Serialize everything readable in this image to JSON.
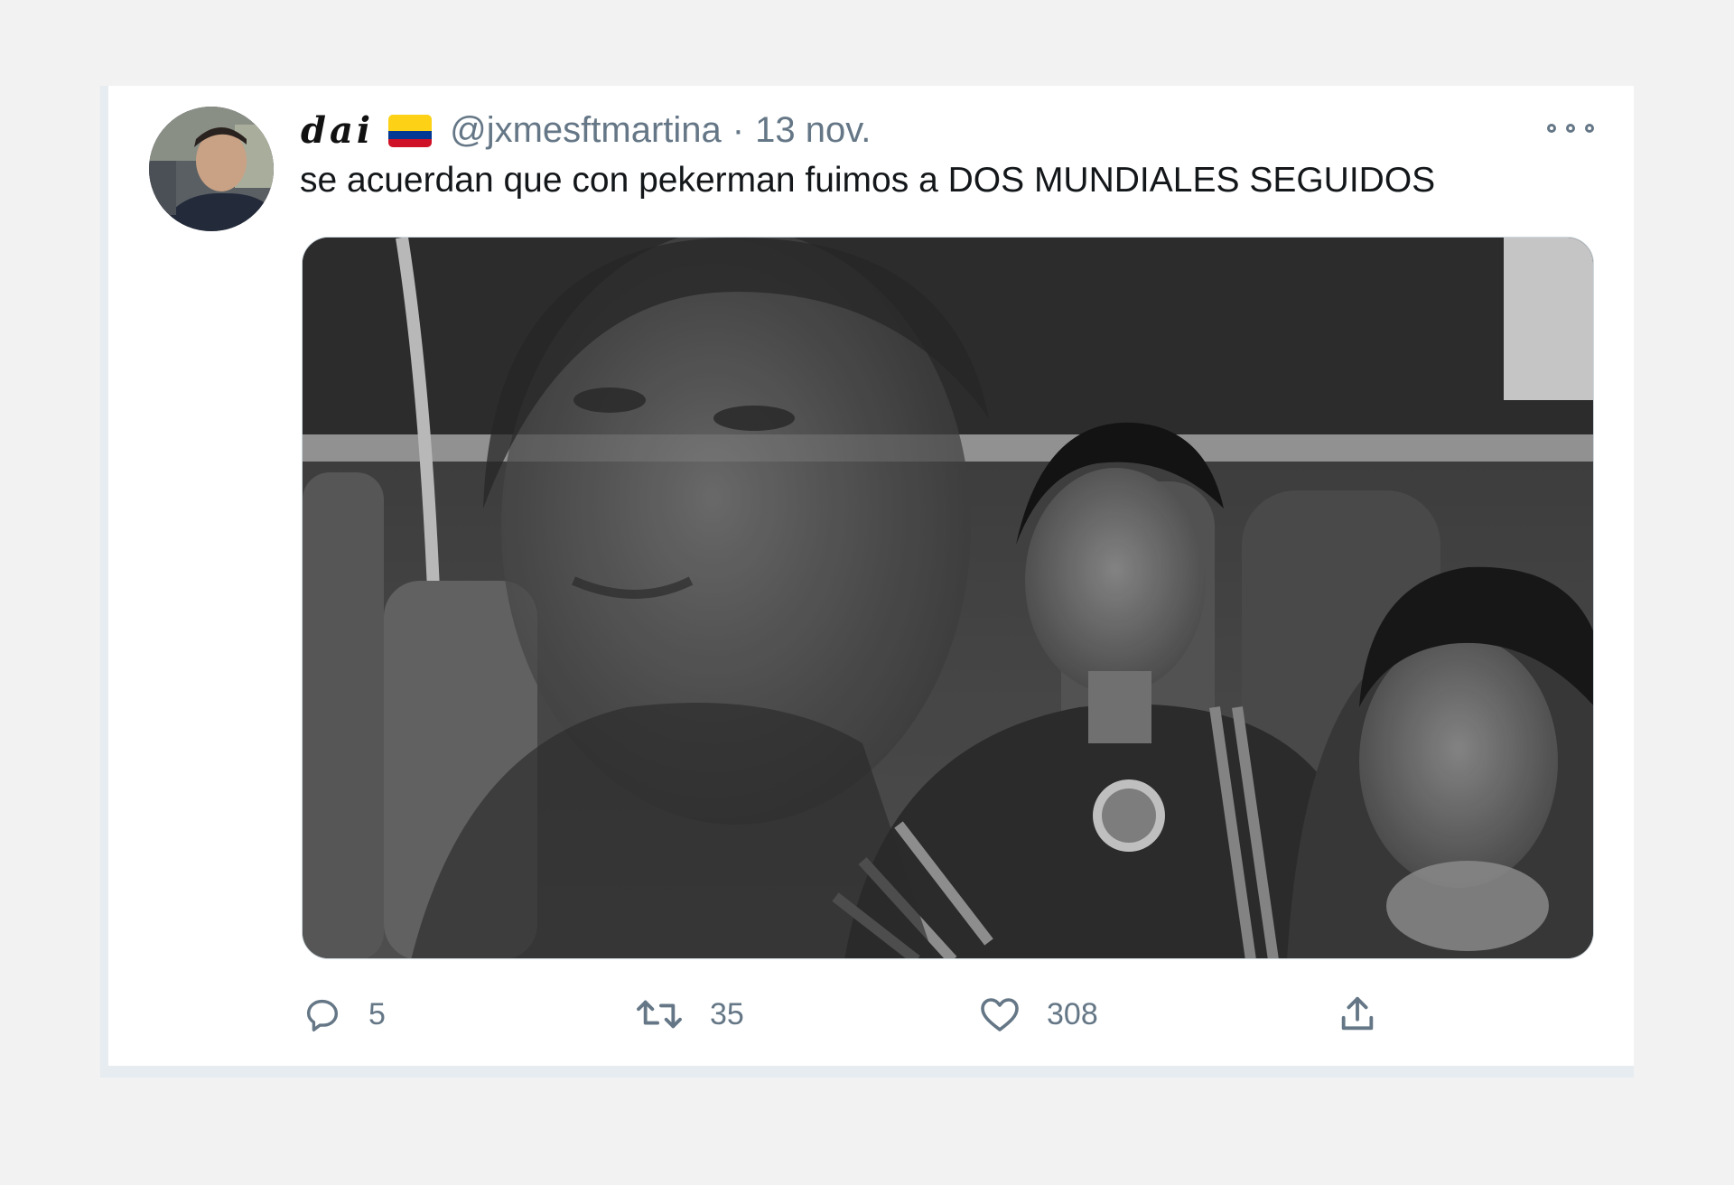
{
  "tweet": {
    "author": {
      "display_name": "dai",
      "flag_icon": "colombia-flag-icon",
      "handle": "@jxmesftmartina"
    },
    "separator": "·",
    "date": "13 nov.",
    "text": "se acuerdan que con pekerman fuimos a DOS MUNDIALES SEGUIDOS",
    "media": {
      "type": "black-and-white photo composite"
    },
    "actions": {
      "reply": {
        "icon": "reply-icon",
        "count": "5"
      },
      "retweet": {
        "icon": "retweet-icon",
        "count": "35"
      },
      "like": {
        "icon": "heart-icon",
        "count": "308"
      },
      "share": {
        "icon": "share-icon"
      }
    }
  },
  "colors": {
    "background": "#f2f2f2",
    "card": "#ffffff",
    "secondary_text": "#657786",
    "primary_text": "#14171a",
    "flag_yellow": "#fcd116",
    "flag_blue": "#003893",
    "flag_red": "#ce1126"
  }
}
